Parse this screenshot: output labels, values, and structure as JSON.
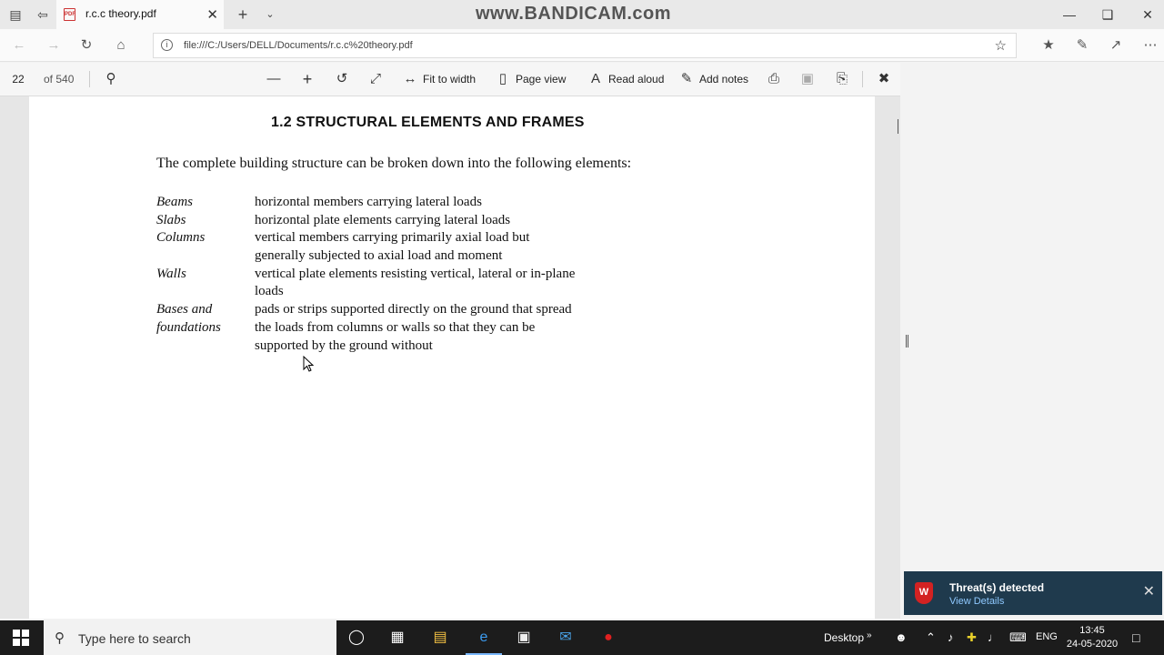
{
  "browser": {
    "tab_title": "r.c.c theory.pdf",
    "watermark": "www.BANDICAM.com",
    "url": "file:///C:/Users/DELL/Documents/r.c.c%20theory.pdf"
  },
  "pdf_toolbar": {
    "page_current": "22",
    "page_total": "of 540",
    "fit_to_width": "Fit to width",
    "page_view": "Page view",
    "read_aloud": "Read aloud",
    "add_notes": "Add notes"
  },
  "document": {
    "heading": "1.2 STRUCTURAL ELEMENTS AND FRAMES",
    "intro": "The complete building structure can be broken down into the following elements:",
    "definitions": [
      {
        "term": [
          "Beams"
        ],
        "lines": [
          "horizontal members carrying lateral loads"
        ]
      },
      {
        "term": [
          "Slabs"
        ],
        "lines": [
          "horizontal plate elements carrying lateral loads"
        ]
      },
      {
        "term": [
          "Columns"
        ],
        "lines": [
          "vertical members carrying primarily axial load but",
          "generally subjected to axial load and moment"
        ]
      },
      {
        "term": [
          "Walls"
        ],
        "lines": [
          "vertical plate elements resisting vertical, lateral or in-plane",
          "loads"
        ]
      },
      {
        "term": [
          "Bases and",
          "foundations"
        ],
        "lines": [
          "pads or strips supported directly on the ground that spread",
          "the loads from columns or walls so that they can be",
          "supported by the ground without"
        ]
      }
    ]
  },
  "toast": {
    "title": "Threat(s) detected",
    "link": "View Details"
  },
  "taskbar": {
    "search_placeholder": "Type here to search",
    "desktop_label": "Desktop",
    "lang": "ENG",
    "time": "13:45",
    "date": "24-05-2020"
  },
  "colors": {
    "toast_bg": "#1f3a4d",
    "taskbar_bg": "#1c1c1c",
    "link": "#8fc9ff"
  }
}
